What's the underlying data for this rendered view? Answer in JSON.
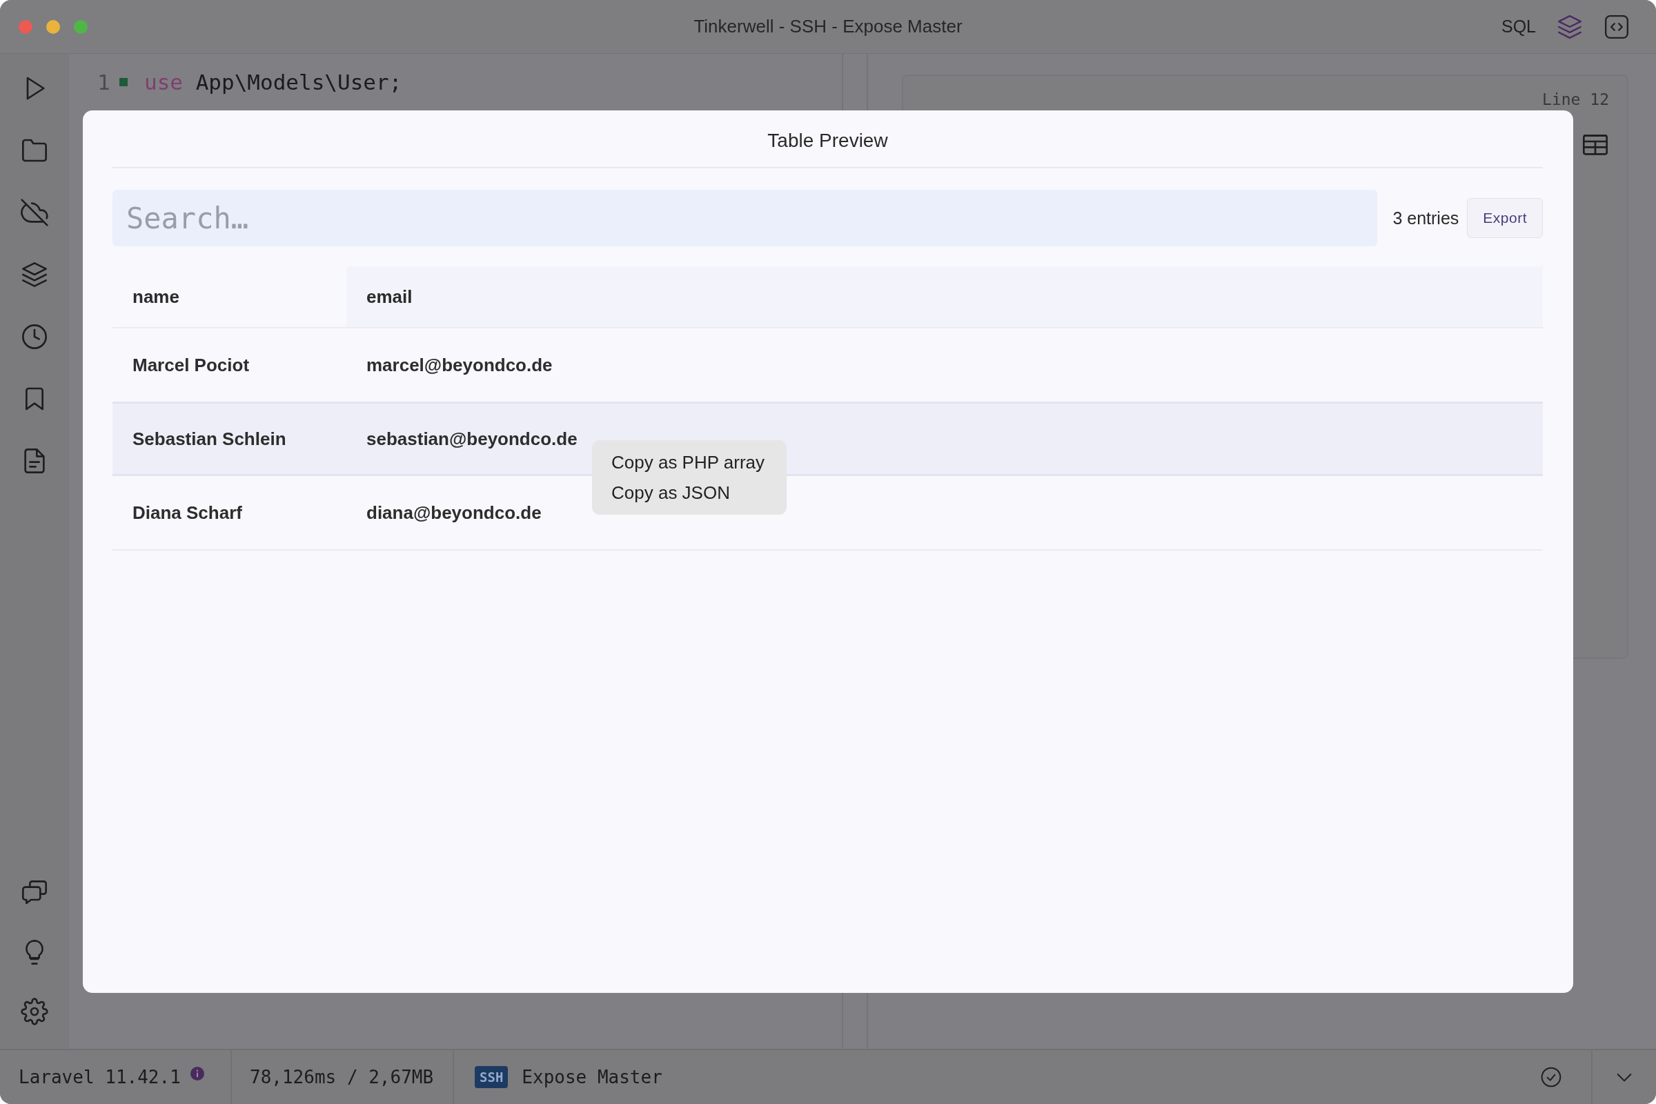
{
  "window": {
    "title": "Tinkerwell - SSH - Expose Master",
    "toolbar": {
      "sql_label": "SQL",
      "buttons": [
        {
          "kind": "layers",
          "selected": true
        },
        {
          "kind": "code",
          "selected": false
        }
      ]
    }
  },
  "editor": {
    "lines": [
      {
        "number": "1",
        "marked": true,
        "tokens": [
          {
            "kind": "keyword",
            "text": "use"
          },
          {
            "kind": "plain",
            "text": "App\\Models\\User;"
          }
        ]
      }
    ]
  },
  "result": {
    "line_label": "Line 12"
  },
  "modal": {
    "title": "Table Preview",
    "search": {
      "placeholder": "Search…"
    },
    "count": "3 entries",
    "export_button": "Export",
    "table": {
      "columns": [
        "name",
        "email"
      ],
      "rows": [
        {
          "cells": [
            "Marcel Pociot",
            "marcel@beyondco.de"
          ],
          "selected": false
        },
        {
          "cells": [
            "Sebastian Schlein",
            "sebastian@beyondco.de"
          ],
          "selected": true
        },
        {
          "cells": [
            "Diana Scharf",
            "diana@beyondco.de"
          ],
          "selected": false
        }
      ]
    },
    "context_menu": {
      "items": [
        "Copy as PHP array",
        "Copy as JSON"
      ]
    }
  },
  "status_bar": {
    "version": "Laravel 11.42.1",
    "timing": "78,126ms / 2,67MB",
    "connection_badge": "SSH",
    "connection_name": "Expose Master"
  }
}
